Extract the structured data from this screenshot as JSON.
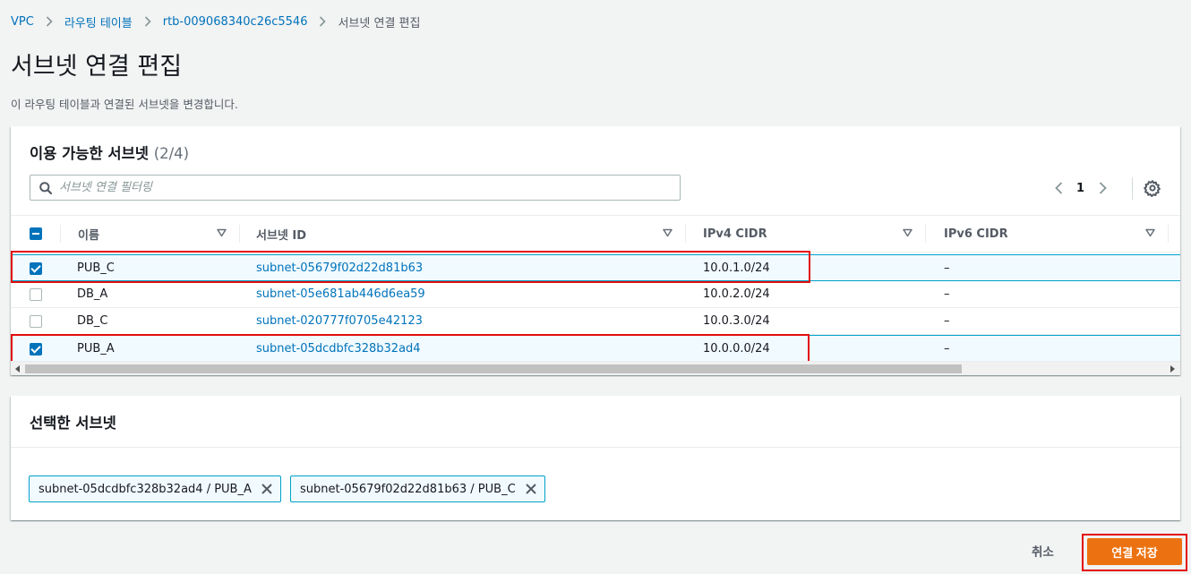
{
  "breadcrumb": {
    "items": [
      "VPC",
      "라우팅 테이블",
      "rtb-009068340c26c5546"
    ],
    "current": "서브넷 연결 편집"
  },
  "page": {
    "title": "서브넷 연결 편집",
    "description": "이 라우팅 테이블과 연결된 서브넷을 변경합니다."
  },
  "available": {
    "title": "이용 가능한 서브넷",
    "count": "(2/4)",
    "filter_placeholder": "서브넷 연결 필터링",
    "page_number": "1",
    "columns": [
      "이름",
      "서브넷 ID",
      "IPv4 CIDR",
      "IPv6 CIDR"
    ],
    "rows": [
      {
        "name": "PUB_C",
        "subnet_id": "subnet-05679f02d22d81b63",
        "ipv4": "10.0.1.0/24",
        "ipv6": "–",
        "checked": true
      },
      {
        "name": "DB_A",
        "subnet_id": "subnet-05e681ab446d6ea59",
        "ipv4": "10.0.2.0/24",
        "ipv6": "–",
        "checked": false
      },
      {
        "name": "DB_C",
        "subnet_id": "subnet-020777f0705e42123",
        "ipv4": "10.0.3.0/24",
        "ipv6": "–",
        "checked": false
      },
      {
        "name": "PUB_A",
        "subnet_id": "subnet-05dcdbfc328b32ad4",
        "ipv4": "10.0.0.0/24",
        "ipv6": "–",
        "checked": true
      }
    ]
  },
  "selected": {
    "title": "선택한 서브넷",
    "tokens": [
      "subnet-05dcdbfc328b32ad4 / PUB_A",
      "subnet-05679f02d22d81b63 / PUB_C"
    ]
  },
  "footer": {
    "cancel_label": "취소",
    "save_label": "연결 저장"
  },
  "colors": {
    "accent": "#0073bb",
    "primary_button": "#ec7211",
    "highlight": "#e30c0c"
  }
}
